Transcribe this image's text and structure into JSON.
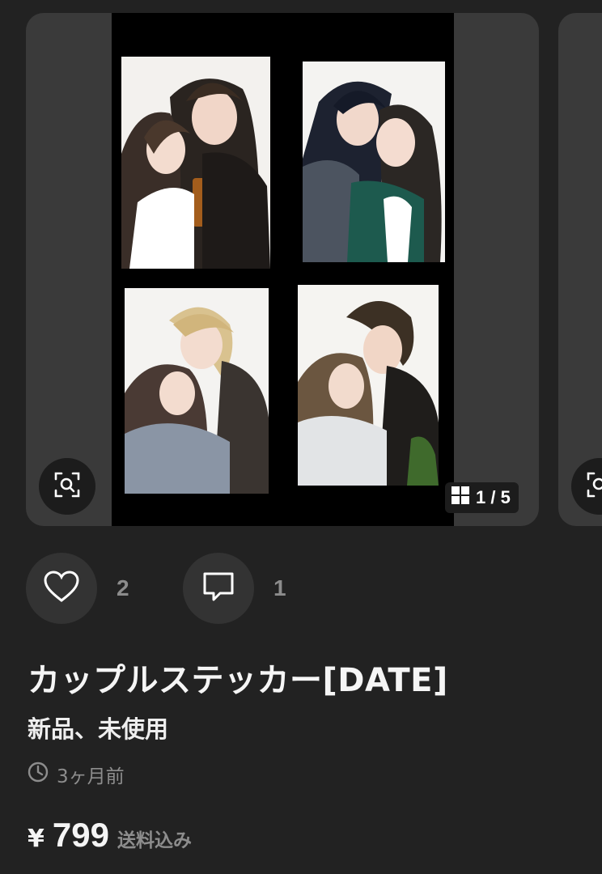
{
  "gallery": {
    "counter": "1 / 5",
    "current": 1,
    "total": 5
  },
  "actions": {
    "like_count": "2",
    "comment_count": "1"
  },
  "item": {
    "title": "カップルステッカー[DATE]",
    "condition": "新品、未使用",
    "posted": "3ヶ月前",
    "currency": "¥",
    "price": "799",
    "shipping": "送料込み"
  },
  "icons": {
    "zoom": "scan-zoom-icon",
    "counter": "grid-icon",
    "like": "heart-icon",
    "comment": "comment-icon",
    "time": "clock-icon"
  },
  "colors": {
    "background": "#222222",
    "card": "#3a3a3a",
    "muted_text": "#8d8d8d"
  }
}
